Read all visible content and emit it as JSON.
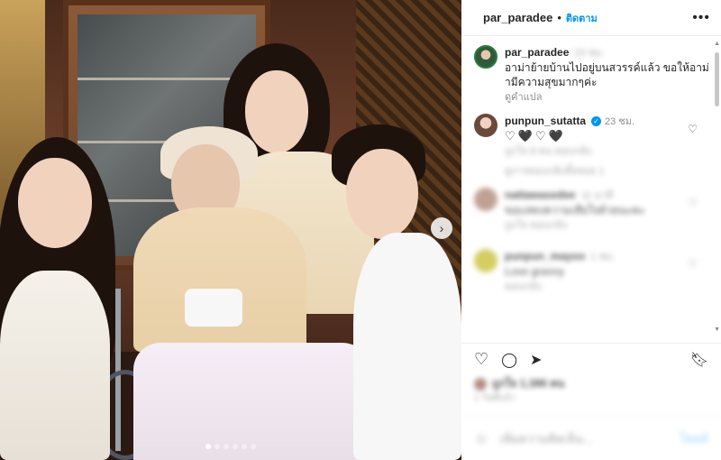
{
  "post": {
    "username": "par_paradee",
    "follow_label": "ติดตาม",
    "more_icon": "•••"
  },
  "caption": {
    "username": "par_paradee",
    "time": "23 ชม.",
    "text": "อาม่าย้ายบ้านไปอยู่บนสวรรค์แล้ว ขอให้อาม่ามีความสุขมากๆค่ะ",
    "translate_label": "ดูคำแปล"
  },
  "comments": [
    {
      "username": "punpun_sutatta",
      "verified": true,
      "time": "23 ชม.",
      "text": "♡🖤♡🖤",
      "likes": "ถูกใจ 8 คน",
      "reply": "ตอบกลับ",
      "view_replies": "ดูการตอบกลับทั้งหมด 1"
    },
    {
      "username": "nattawasedee",
      "time": "11 นาที",
      "text": "ขอแสดงความเสียใจด้วยนะคะ",
      "reply": "ตอบกลับ",
      "likes": "ถูกใจ"
    },
    {
      "username": "punpun_mayoo",
      "time": "1 ชม.",
      "text": "Love granny",
      "reply": "ตอบกลับ"
    }
  ],
  "footer": {
    "likes_text": "ถูกใจ 1,386 คน",
    "date": "1 วันที่แล้ว",
    "add_comment_placeholder": "เพิ่มความคิดเห็น...",
    "post_label": "โพสต์"
  },
  "colors": {
    "accent": "#0095f6",
    "text": "#262626",
    "muted": "#8e8e8e"
  }
}
